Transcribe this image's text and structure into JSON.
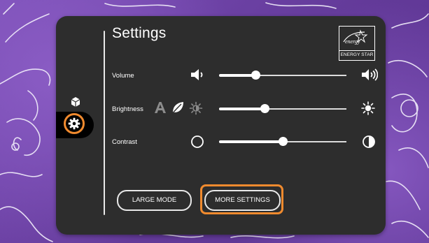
{
  "settings": {
    "title": "Settings",
    "energy_star_script": "energy",
    "energy_star_label": "ENERGY STAR"
  },
  "sidebar": {
    "items": [
      {
        "icon": "cube-icon"
      },
      {
        "icon": "gear-icon",
        "selected": true
      }
    ]
  },
  "rows": {
    "volume": {
      "label": "Volume",
      "value": 0.29
    },
    "brightness": {
      "label": "Brightness",
      "value": 0.36
    },
    "contrast": {
      "label": "Contrast",
      "value": 0.5
    }
  },
  "buttons": {
    "large_mode": "LARGE MODE",
    "more_settings": "MORE SETTINGS"
  },
  "colors": {
    "highlight": "#f08a2e",
    "panel": "#2d2d2d",
    "wallpaper": "#6a3fa0"
  }
}
